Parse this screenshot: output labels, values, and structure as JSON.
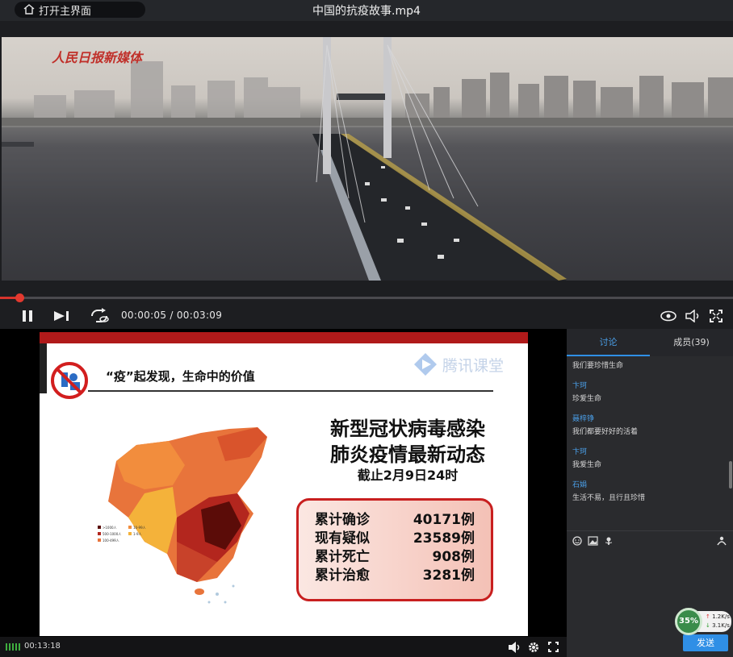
{
  "player": {
    "home_label": "打开主界面",
    "file_title": "中国的抗疫故事.mp4",
    "watermark": "人民日报新媒体",
    "time_display": "00:00:05 / 00:03:09",
    "progress_fraction": 0.026
  },
  "slide": {
    "heading": "“疫”起发现，生命中的价值",
    "logo_text": "腾讯课堂",
    "title_line1": "新型冠状病毒感染",
    "title_line2": "肺炎疫情最新动态",
    "date": "截止2月9日24时",
    "stats": [
      {
        "label": "累计确诊",
        "value": "40171例"
      },
      {
        "label": "现有疑似",
        "value": "23589例"
      },
      {
        "label": "累计死亡",
        "value": "908例"
      },
      {
        "label": "累计治愈",
        "value": "3281例"
      }
    ]
  },
  "lesson_bar": {
    "time": "00:13:18"
  },
  "chat": {
    "tab_discuss": "讨论",
    "tab_members": "成员(39)",
    "messages": [
      {
        "name": "",
        "text": "我们要珍惜生命"
      },
      {
        "name": "卞珂",
        "text": "珍爱生命"
      },
      {
        "name": "聂梓铮",
        "text": "我们都要好好的活着"
      },
      {
        "name": "卞珂",
        "text": "我爱生命"
      },
      {
        "name": "石娟",
        "text": "生活不易，且行且珍惜"
      }
    ],
    "send_label": "发送"
  },
  "net": {
    "percent": "35%",
    "up": "1.2K/s",
    "down": "3.1K/s"
  },
  "colors": {
    "accent_blue": "#2f8fe6",
    "progress_red": "#d8342c",
    "slide_red": "#b01a1a"
  }
}
